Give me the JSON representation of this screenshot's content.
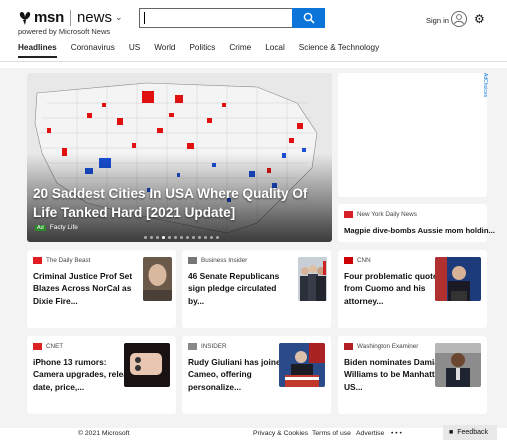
{
  "header": {
    "brand": "msn",
    "section": "news",
    "powered_by": "powered by Microsoft News",
    "search_value": "",
    "sign_in": "Sign in",
    "icons": [
      "msn-butterfly-icon",
      "chevron-down-icon",
      "search-icon",
      "avatar-icon",
      "gear-icon"
    ]
  },
  "nav": {
    "tabs": [
      "Headlines",
      "Coronavirus",
      "US",
      "World",
      "Politics",
      "Crime",
      "Local",
      "Science & Technology"
    ],
    "active": "Headlines"
  },
  "hero": {
    "title": "20 Saddest Cities In USA Where Quality Of Life Tanked Hard [2021 Update]",
    "ad_badge": "Ad",
    "source": "Facty Life",
    "slide_count": 13,
    "active_slide": 3
  },
  "ad": {
    "label": "AdChoices"
  },
  "side_story": {
    "source": "New York Daily News",
    "title": "Magpie dive-bombs Aussie mom holdin..."
  },
  "cards": [
    {
      "source": "The Daily Beast",
      "title": "Criminal Justice Prof Set Blazes Across NorCal as Dixie Fire...",
      "thumb": "man-portrait"
    },
    {
      "source": "Business Insider",
      "title": "46 Senate Republicans sign pledge circulated by...",
      "thumb": "senators-group"
    },
    {
      "source": "CNN",
      "title": "Four problematic quotes from Cuomo and his attorney...",
      "thumb": "cuomo-podium"
    },
    {
      "source": "CNET",
      "title": "iPhone 13 rumors: Camera upgrades, release date, price,...",
      "thumb": "iphone-cameras"
    },
    {
      "source": "INSIDER",
      "title": "Rudy Giuliani has joined Cameo, offering personalize...",
      "thumb": "giuliani-podium"
    },
    {
      "source": "Washington Examiner",
      "title": "Biden nominates Damian Williams to be Manhattan US...",
      "thumb": "damian-williams"
    }
  ],
  "footer": {
    "copyright": "© 2021 Microsoft",
    "links": [
      "Privacy & Cookies",
      "Terms of use",
      "Advertise"
    ],
    "more": "• • •",
    "feedback": "Feedback"
  }
}
